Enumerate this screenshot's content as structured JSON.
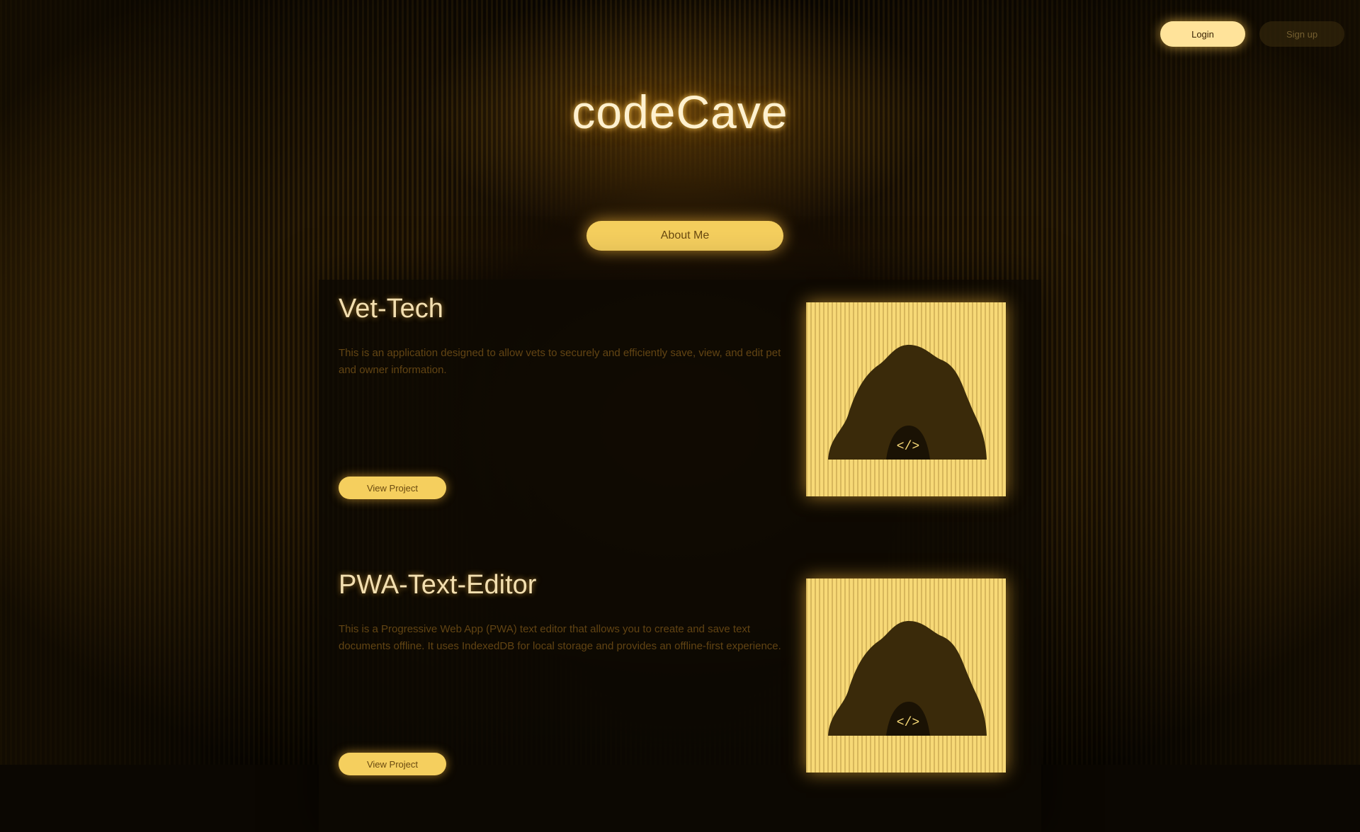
{
  "header": {
    "login_label": "Login",
    "signup_label": "Sign up"
  },
  "logo": {
    "text": "codeCave"
  },
  "hero": {
    "button_label": "About Me"
  },
  "projects": [
    {
      "title": "Vet-Tech",
      "description": "This is an application designed to allow vets to securely and efficiently save, view, and edit pet and owner information.",
      "meta": "",
      "button_label": "View Project",
      "image_icon": "cave-code-icon"
    },
    {
      "title": "PWA-Text-Editor",
      "description": "This is a Progressive Web App (PWA) text editor that allows you to create and save text documents offline. It uses IndexedDB for local storage and provides an offline-first experience.",
      "meta": "",
      "button_label": "View Project",
      "image_icon": "cave-code-icon"
    }
  ],
  "colors": {
    "accent": "#f5cf5e",
    "glow": "#ffbe3c",
    "title_text": "#f3dfb0",
    "background": "#0b0702"
  }
}
